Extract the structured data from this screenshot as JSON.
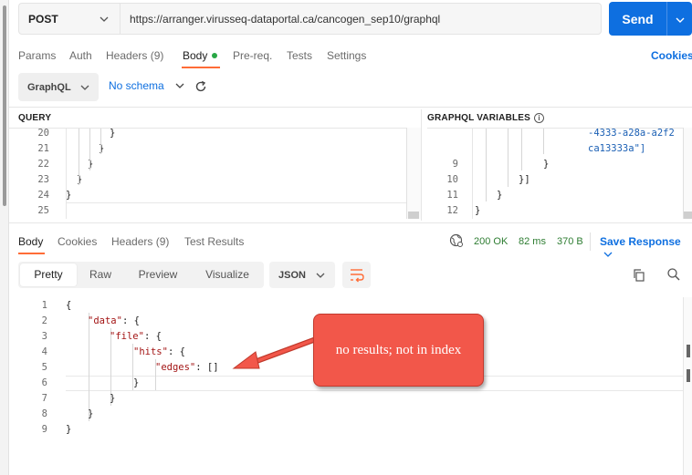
{
  "request": {
    "method": "POST",
    "url": "https://arranger.virusseq-dataportal.ca/cancogen_sep10/graphql",
    "send_label": "Send"
  },
  "request_tabs": [
    {
      "label": "Params"
    },
    {
      "label": "Auth"
    },
    {
      "label": "Headers (9)"
    },
    {
      "label": "Body",
      "active": true
    },
    {
      "label": "Pre-req."
    },
    {
      "label": "Tests"
    },
    {
      "label": "Settings"
    }
  ],
  "cookies_label": "Cookies",
  "graphql_toolbar": {
    "mode": "GraphQL",
    "schema": "No schema"
  },
  "query_pane": {
    "title": "QUERY",
    "lines": [
      {
        "num": "20",
        "text": "}"
      },
      {
        "num": "21",
        "text": "}"
      },
      {
        "num": "22",
        "text": "}"
      },
      {
        "num": "23",
        "text": "}"
      },
      {
        "num": "24",
        "text": "}"
      },
      {
        "num": "25",
        "text": ""
      }
    ]
  },
  "variables_pane": {
    "title": "GRAPHQL VARIABLES",
    "lines": [
      {
        "num": "",
        "text": "-4333-a28a-a2f2"
      },
      {
        "num": "",
        "text": "ca13333a\"]"
      },
      {
        "num": "9",
        "text": "}"
      },
      {
        "num": "10",
        "text": "}]"
      },
      {
        "num": "11",
        "text": "}"
      },
      {
        "num": "12",
        "text": "}"
      }
    ]
  },
  "response_tabs": [
    {
      "label": "Body",
      "active": true
    },
    {
      "label": "Cookies"
    },
    {
      "label": "Headers (9)"
    },
    {
      "label": "Test Results"
    }
  ],
  "response_status": {
    "status": "200 OK",
    "time": "82 ms",
    "size": "370 B",
    "save_label": "Save Response"
  },
  "view_tabs": [
    {
      "label": "Pretty",
      "active": true
    },
    {
      "label": "Raw"
    },
    {
      "label": "Preview"
    },
    {
      "label": "Visualize"
    }
  ],
  "format_select": "JSON",
  "response_body": [
    {
      "num": "1",
      "key": "",
      "rest": "{"
    },
    {
      "num": "2",
      "key": "\"data\"",
      "rest": ": {"
    },
    {
      "num": "3",
      "key": "\"file\"",
      "rest": ": {"
    },
    {
      "num": "4",
      "key": "\"hits\"",
      "rest": ": {"
    },
    {
      "num": "5",
      "key": "\"edges\"",
      "rest": ": []"
    },
    {
      "num": "6",
      "key": "",
      "rest": "}"
    },
    {
      "num": "7",
      "key": "",
      "rest": "}"
    },
    {
      "num": "8",
      "key": "",
      "rest": "}"
    },
    {
      "num": "9",
      "key": "",
      "rest": "}"
    }
  ],
  "annotation": {
    "text": "no results; not in index"
  },
  "colors": {
    "accent": "#0e6fe0",
    "active_tab": "#ff6c37",
    "status_ok": "#2e7d32",
    "annotation_fill": "#f2574a",
    "json_key": "#a31515"
  }
}
